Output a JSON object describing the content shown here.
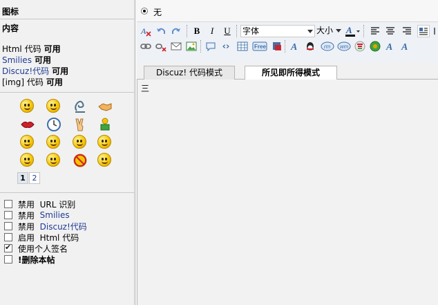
{
  "left": {
    "icon_label": "图标",
    "content_label": "内容",
    "code_lines": [
      {
        "name": "Html 代码",
        "status": "可用",
        "link": false
      },
      {
        "name": "Smilies",
        "status": "可用",
        "link": true
      },
      {
        "name": "Discuz!代码",
        "status": "可用",
        "link": true
      },
      {
        "name": "[img] 代码",
        "status": "可用",
        "link": false
      }
    ],
    "pager": [
      "1",
      "2"
    ],
    "options": [
      {
        "prefix": "禁用 ",
        "text": " URL 识别",
        "blue": false,
        "checked": false
      },
      {
        "prefix": "禁用 ",
        "text": " Smilies",
        "blue": true,
        "checked": false
      },
      {
        "prefix": "禁用 ",
        "text": " Discuz!代码",
        "blue": true,
        "checked": false
      },
      {
        "prefix": "启用 ",
        "text": " Html 代码",
        "blue": false,
        "checked": false
      },
      {
        "prefix": "",
        "text": "使用个人签名",
        "blue": false,
        "checked": true
      },
      {
        "prefix": "",
        "text": "!删除本帖",
        "blue": false,
        "checked": false,
        "bold": true
      }
    ]
  },
  "right": {
    "radio_label": "无",
    "font_select": "字体",
    "size_select": "大小",
    "tabs": [
      "Discuz! 代码模式",
      "所见即所得模式"
    ],
    "active_tab": 1,
    "editor_content": "三"
  },
  "colors": {
    "link": "#1f3a93",
    "panel_bg": "#f1f1f1",
    "toolbar_bg": "#eef1f6"
  }
}
